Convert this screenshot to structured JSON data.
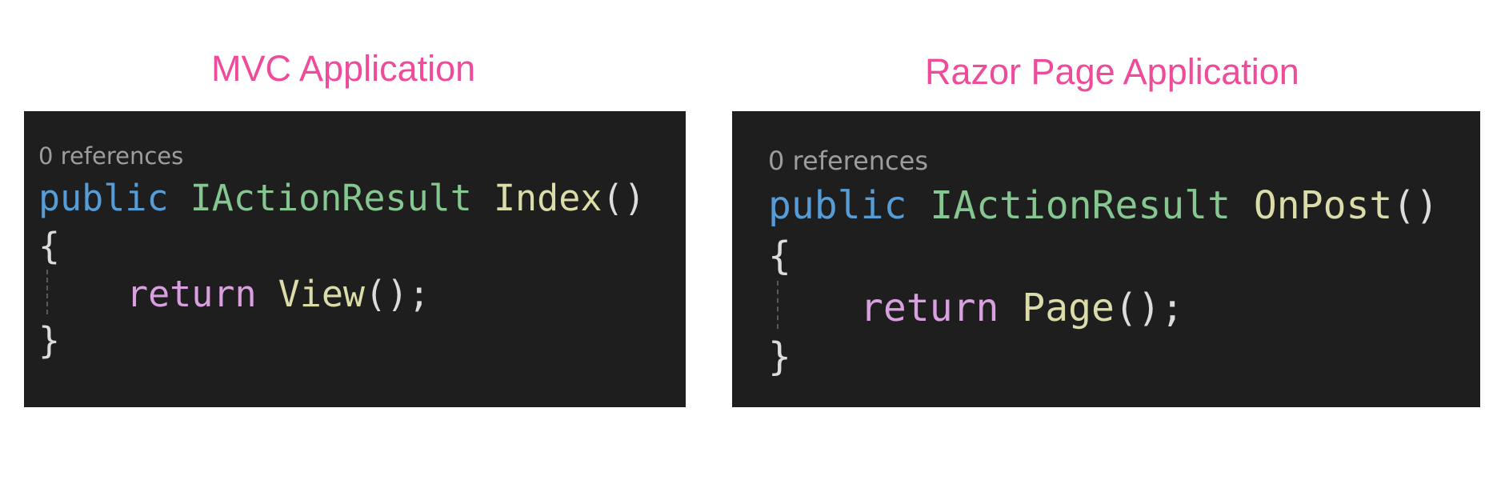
{
  "panels": [
    {
      "title": "MVC Application",
      "codelens": "0 references",
      "signature": {
        "keyword": "public",
        "return_type": "IActionResult",
        "method": "Index",
        "parens": "()"
      },
      "open_brace": "{",
      "body": {
        "keyword": "return",
        "call": "View",
        "tail": "();"
      },
      "close_brace": "}"
    },
    {
      "title": "Razor Page Application",
      "codelens": "0 references",
      "signature": {
        "keyword": "public",
        "return_type": "IActionResult",
        "method": "OnPost",
        "parens": "()"
      },
      "open_brace": "{",
      "body": {
        "keyword": "return",
        "call": "Page",
        "tail": "();"
      },
      "close_brace": "}"
    }
  ],
  "colors": {
    "title": "#ee4b9a",
    "editor_background": "#1e1e1e",
    "codelens": "#9d9d9d",
    "keyword": "#569cd6",
    "control_keyword": "#d8a0df",
    "type": "#86c691",
    "method": "#dcdcaa",
    "punctuation": "#dcdcdc"
  }
}
